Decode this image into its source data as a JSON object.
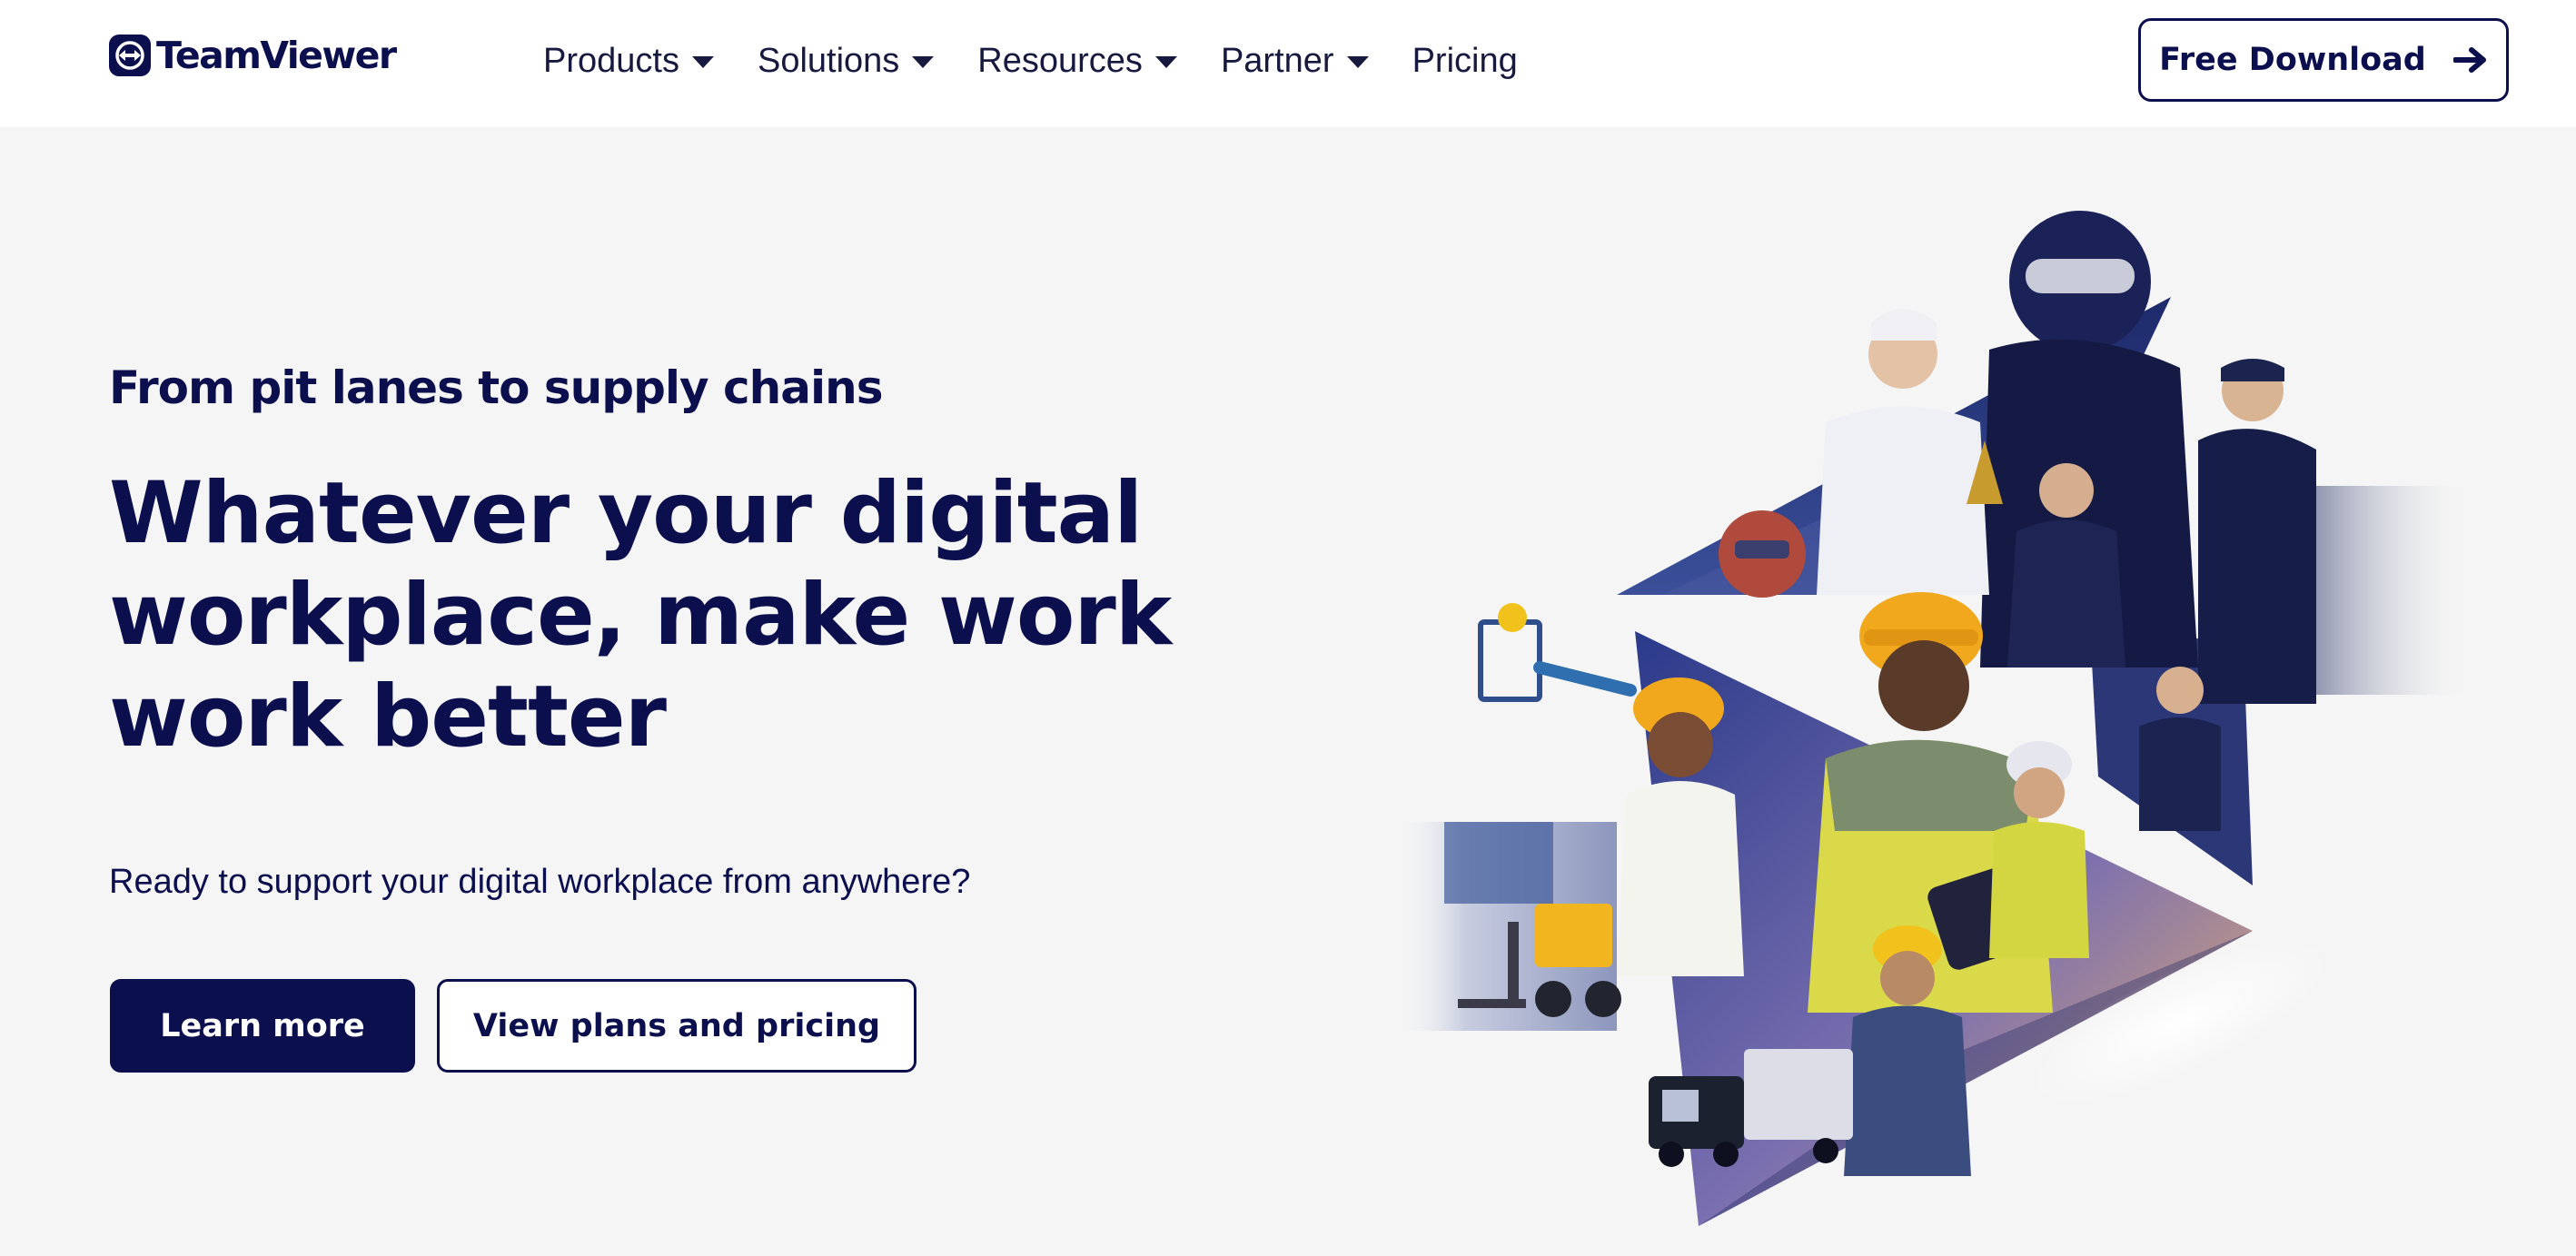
{
  "header": {
    "brand": "TeamViewer",
    "nav": [
      {
        "label": "Products",
        "has_dropdown": true
      },
      {
        "label": "Solutions",
        "has_dropdown": true
      },
      {
        "label": "Resources",
        "has_dropdown": true
      },
      {
        "label": "Partner",
        "has_dropdown": true
      },
      {
        "label": "Pricing",
        "has_dropdown": false
      }
    ],
    "cta_label": "Free Download",
    "cta_icon": "arrow-right-icon"
  },
  "hero": {
    "eyebrow": "From pit lanes to supply chains",
    "headline_lines": [
      "Whatever your digital",
      "workplace, make work",
      "work better"
    ],
    "subtext": "Ready to support your digital workplace from anywhere?",
    "primary_button": "Learn more",
    "secondary_button": "View plans and pricing",
    "image_caption": ""
  },
  "colors": {
    "brand_navy": "#0c0f4d",
    "page_background": "#f5f5f5",
    "header_background": "#ffffff"
  }
}
